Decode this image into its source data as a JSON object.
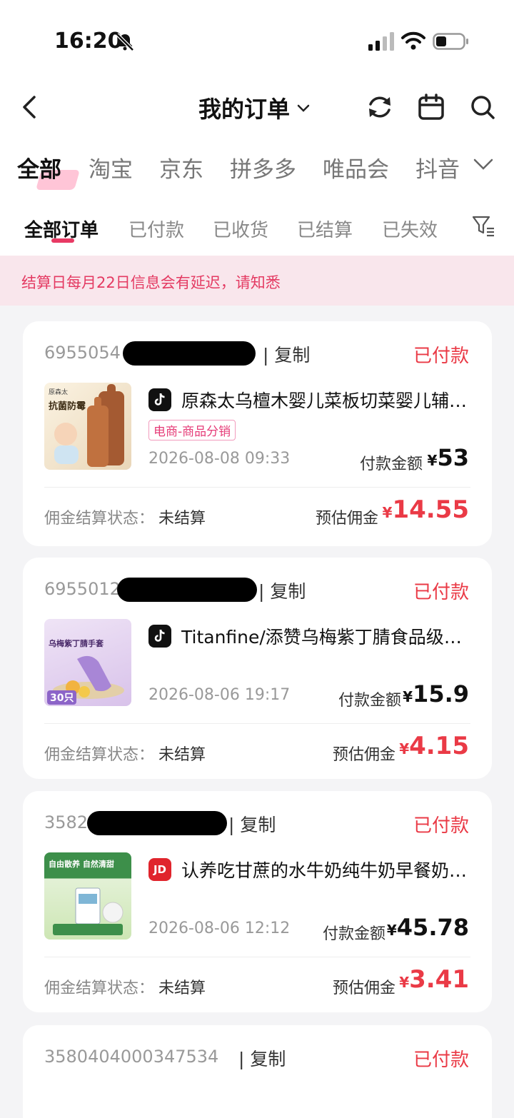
{
  "status_bar": {
    "time": "16:20"
  },
  "header": {
    "title": "我的订单"
  },
  "platform_tabs": [
    "全部",
    "淘宝",
    "京东",
    "拼多多",
    "唯品会",
    "抖音"
  ],
  "order_tabs": [
    "全部订单",
    "已付款",
    "已收货",
    "已结算",
    "已失效"
  ],
  "notice": "结算日每月22日信息会有延迟，请知悉",
  "labels": {
    "copy": "复制",
    "pay_amount": "付款金额",
    "commission_status": "佣金结算状态：",
    "estimated_commission": "预估佣金",
    "currency": "¥"
  },
  "orders": [
    {
      "order_no": "6955054",
      "status": "已付款",
      "platform_icon": "douyin-icon",
      "product": "原森太乌檀木婴儿菜板切菜婴儿辅食砧板",
      "tag": "电商-商品分销",
      "time": "2026-08-08 09:33",
      "pay": "53",
      "commission_status": "未结算",
      "commission": "14.55",
      "thumb_text_1": "抗菌防霉",
      "thumb_text_2": "原森太"
    },
    {
      "order_no": "6955012",
      "status": "已付款",
      "platform_icon": "douyin-icon",
      "product": "Titanfine/添赞乌梅紫丁腈食品级手套",
      "tag": "",
      "time": "2026-08-06 19:17",
      "pay": "15.9",
      "commission_status": "未结算",
      "commission": "4.15",
      "thumb_text_1": "乌梅紫丁腈手套",
      "thumb_text_2": "30只"
    },
    {
      "order_no": "3582",
      "status": "已付款",
      "platform_icon": "jd-icon",
      "product": "认养吃甘蔗的水牛奶纯牛奶早餐奶整箱",
      "tag": "",
      "time": "2026-08-06 12:12",
      "pay": "45.78",
      "commission_status": "未结算",
      "commission": "3.41",
      "thumb_text_1": "自由散养 自然清甜",
      "thumb_text_2": ""
    },
    {
      "order_no": "3580404000347534",
      "status": "已付款"
    }
  ],
  "colors": {
    "accent": "#ea3a46",
    "tab_marker": "#e83a64",
    "notice_bg": "#f9e6ec"
  }
}
